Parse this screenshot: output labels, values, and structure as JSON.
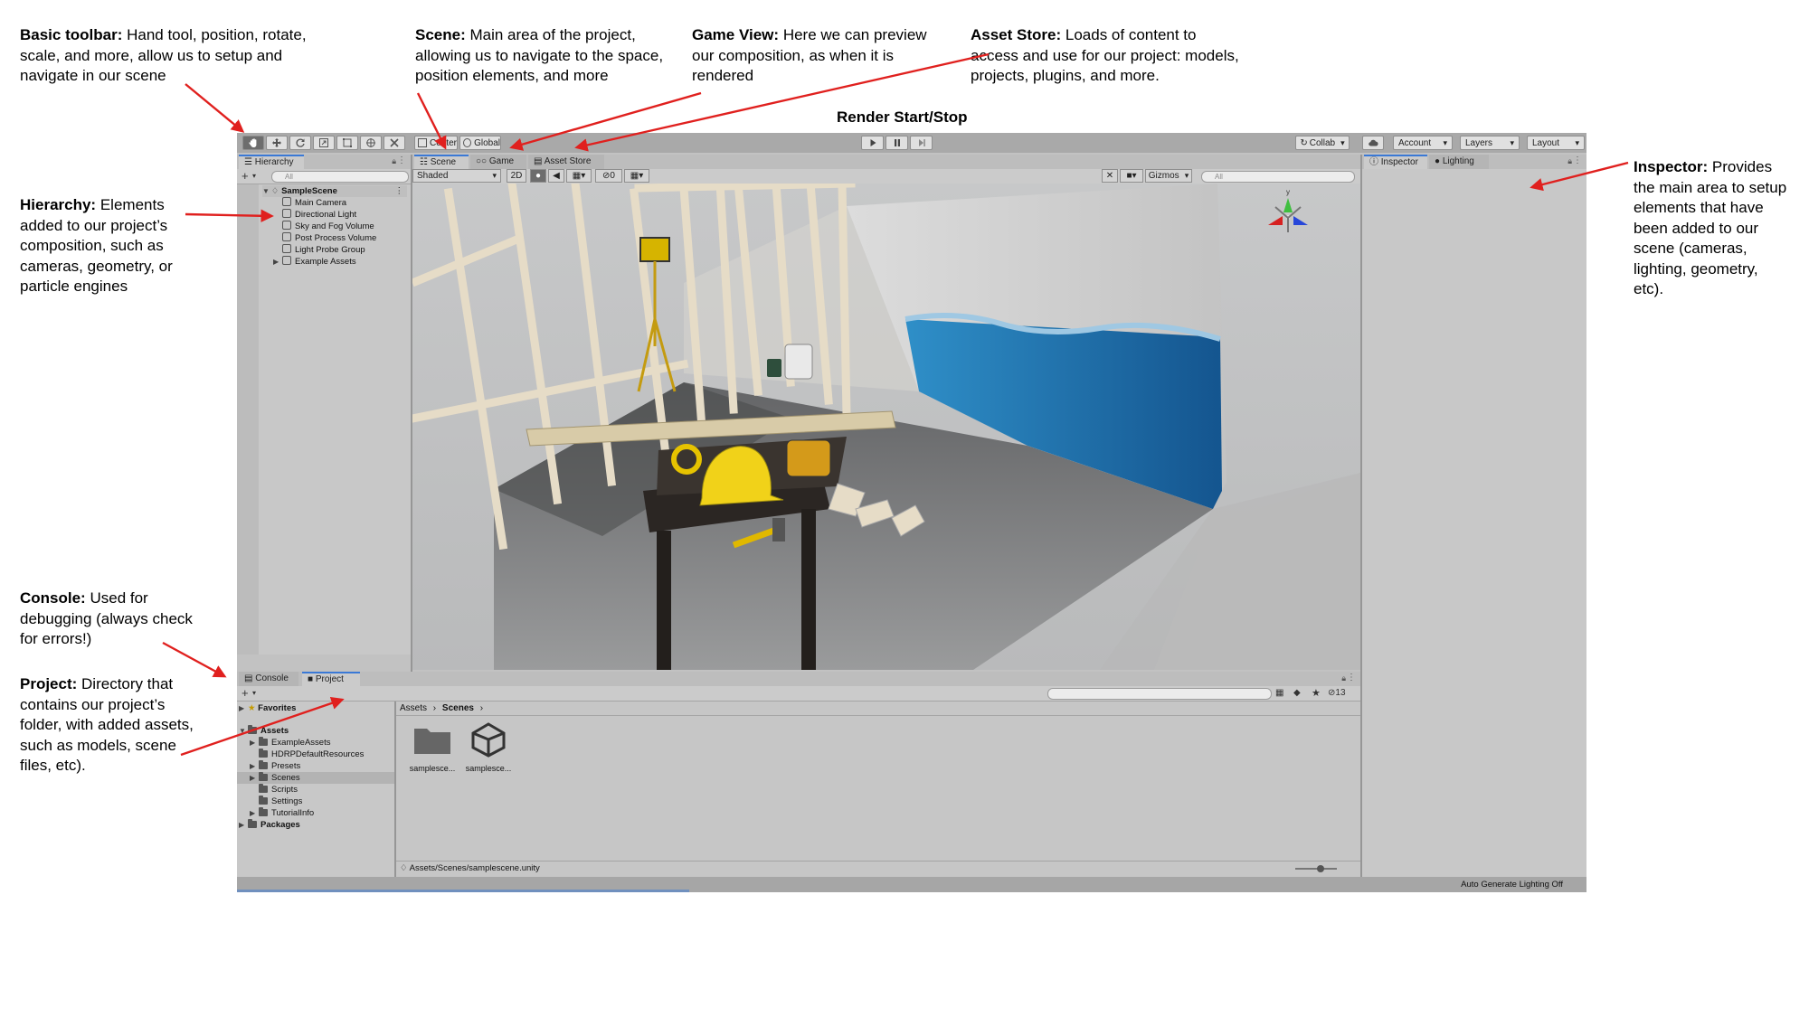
{
  "annotations": {
    "toolbar_title": "Basic toolbar:",
    "toolbar_text": "Hand tool, position, rotate, scale, and more, allow us to setup and navigate in our scene",
    "scene_title": "Scene:",
    "scene_text": "Main area of the project, allowing us to navigate to the space, position elements, and more",
    "game_title": "Game View:",
    "game_text": "Here we can preview our composition, as when it is rendered",
    "asset_title": "Asset Store:",
    "asset_text": "Loads of content to access and use for our project: models, projects, plugins, and more.",
    "render": "Render Start/Stop",
    "hierarchy_title": "Hierarchy:",
    "hierarchy_text": "Elements added to our project’s composition, such as cameras, geometry, or particle engines",
    "inspector_title": "Inspector:",
    "inspector_text": "Provides the main area to setup elements that have been added to our scene (cameras, lighting, geometry, etc).",
    "console_title": "Console:",
    "console_text": "Used for debugging (always check for errors!)",
    "project_title": "Project:",
    "project_text": "Directory that contains our project’s folder, with added assets, such as models, scene files, etc)."
  },
  "toolbar": {
    "tools": [
      "hand-icon",
      "move-icon",
      "rotate-icon",
      "scale-icon",
      "rect-icon",
      "transform-icon",
      "custom-tool-icon"
    ],
    "pivot": "Center",
    "space": "Global",
    "collab": "Collab",
    "account": "Account",
    "layers": "Layers",
    "layout": "Layout"
  },
  "hierarchy": {
    "tab": "Hierarchy",
    "search_placeholder": "All",
    "scene": "SampleScene",
    "items": [
      "Main Camera",
      "Directional Light",
      "Sky and Fog Volume",
      "Post Process Volume",
      "Light Probe Group",
      "Example Assets"
    ]
  },
  "scene_tabs": [
    "Scene",
    "Game",
    "Asset Store"
  ],
  "scene_toolbar": {
    "shading": "Shaded",
    "mode2d": "2D",
    "hidden_count": "0",
    "gizmos": "Gizmos",
    "search_placeholder": "All"
  },
  "inspector_tabs": [
    "Inspector",
    "Lighting"
  ],
  "bottom_tabs": [
    "Console",
    "Project"
  ],
  "project": {
    "favorites": "Favorites",
    "assets": "Assets",
    "folders": [
      "ExampleAssets",
      "HDRPDefaultResources",
      "Presets",
      "Scenes",
      "Scripts",
      "Settings",
      "TutorialInfo"
    ],
    "packages": "Packages",
    "breadcrumb": [
      "Assets",
      "Scenes"
    ],
    "files": [
      "samplesce...",
      "samplesce..."
    ],
    "path": "Assets/Scenes/samplescene.unity",
    "hidden_count": "13"
  },
  "status": {
    "lighting": "Auto Generate Lighting Off"
  },
  "colors": {
    "accent": "#3a79d6",
    "arrow": "#e0201e",
    "toolbar": "#a9a9a9",
    "panel": "#c8c8c8"
  }
}
